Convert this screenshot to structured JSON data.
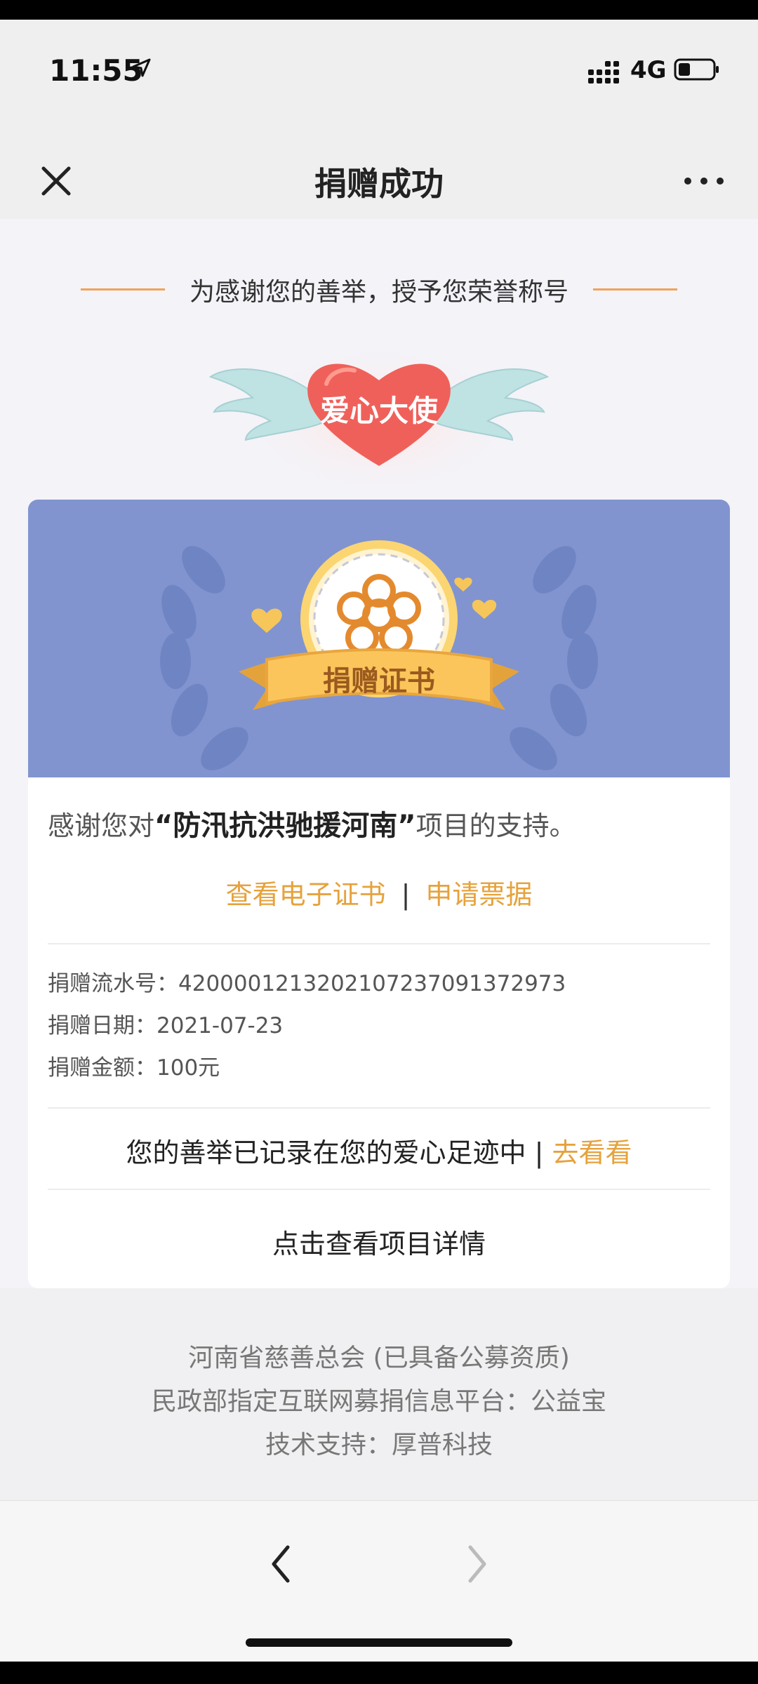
{
  "status_bar": {
    "time": "11:55",
    "network": "4G"
  },
  "nav": {
    "title": "捐赠成功"
  },
  "honor": {
    "heading": "为感谢您的善举，授予您荣誉称号",
    "badge_text": "爱心大使"
  },
  "certificate": {
    "ribbon_text": "捐赠证书"
  },
  "thanks": {
    "prefix": "感谢您对",
    "project": "“防汛抗洪驰援河南”",
    "suffix": "项目的支持。"
  },
  "links": {
    "view_certificate": "查看电子证书",
    "separator": "|",
    "apply_receipt": "申请票据"
  },
  "donation": {
    "serial_label": "捐赠流水号：",
    "serial_value": "4200001213202107237091372973",
    "date_label": "捐赠日期：",
    "date_value": "2021-07-23",
    "amount_label": "捐赠金额：",
    "amount_value": "100元"
  },
  "footprint": {
    "text": "您的善举已记录在您的爱心足迹中",
    "separator": "|",
    "link": "去看看"
  },
  "project_detail": {
    "label": "点击查看项目详情"
  },
  "footer": {
    "line1": "河南省慈善总会 (已具备公募资质)",
    "line2": "民政部指定互联网募捐信息平台：公益宝",
    "line3": "技术支持：厚普科技"
  },
  "colors": {
    "accent": "#e6a23c",
    "banner": "#8194cf",
    "heart": "#f0605a"
  }
}
